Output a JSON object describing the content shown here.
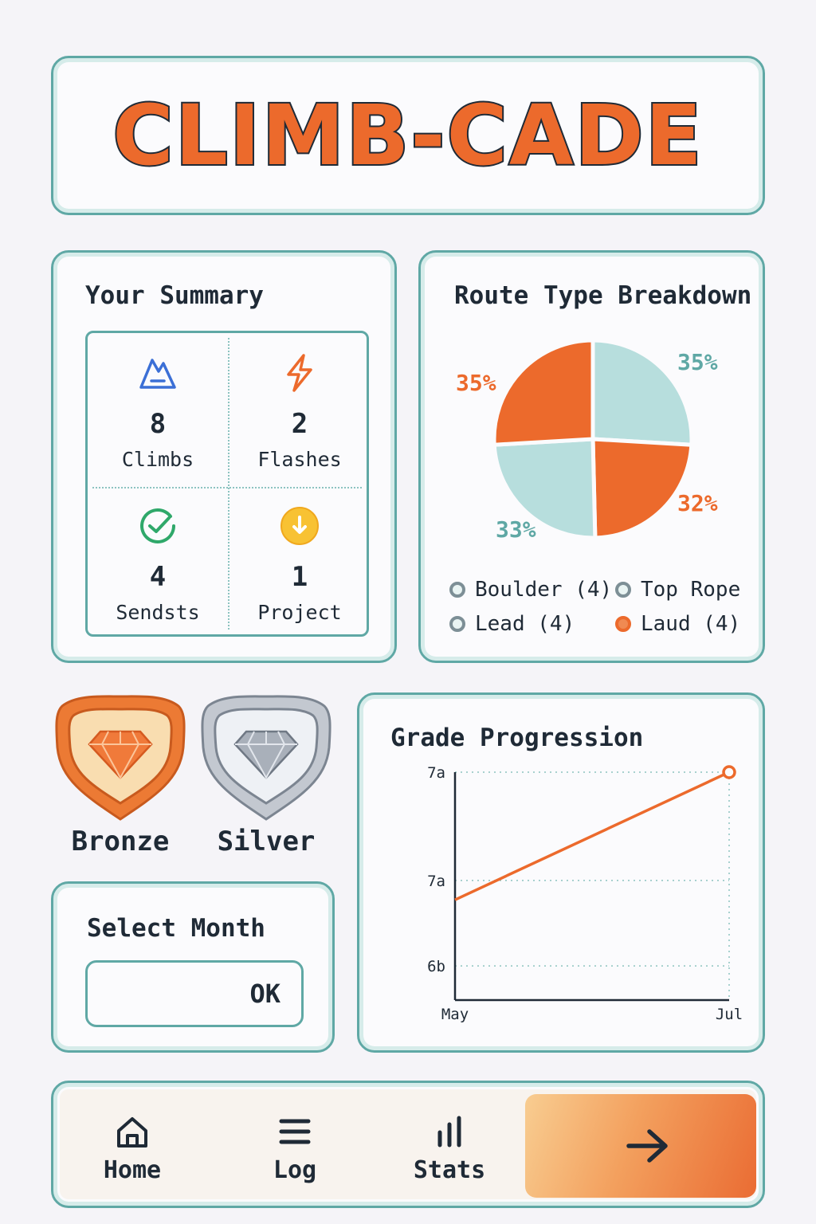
{
  "header": {
    "title": "CLIMB-CADE"
  },
  "summary": {
    "title": "Your Summary",
    "stats": [
      {
        "value": "8",
        "label": "Climbs",
        "icon": "mountain-icon",
        "color": "#3b6fd6"
      },
      {
        "value": "2",
        "label": "Flashes",
        "icon": "lightning-icon",
        "color": "#ec6a2c"
      },
      {
        "value": "4",
        "label": "Sendsts",
        "icon": "check-circle-icon",
        "color": "#2fa86a"
      },
      {
        "value": "1",
        "label": "Project",
        "icon": "arrow-down-circle-icon",
        "color": "#f5b52b"
      }
    ]
  },
  "route_breakdown": {
    "title": "Route Type Breakdown",
    "legend": [
      {
        "label": "Boulder (4)",
        "color": "#7d8f96"
      },
      {
        "label": "Top Rope",
        "color": "#7d8f96"
      },
      {
        "label": "Lead (4)",
        "color": "#7d8f96"
      },
      {
        "label": "Laud (4)",
        "color": "#ec6a2c"
      }
    ]
  },
  "badges": [
    {
      "label": "Bronze",
      "icon": "bronze-gem-badge-icon"
    },
    {
      "label": "Silver",
      "icon": "silver-gem-badge-icon"
    }
  ],
  "month_select": {
    "title": "Select Month",
    "button_label": "OK"
  },
  "grade_progression": {
    "title": "Grade Progression"
  },
  "nav": {
    "items": [
      {
        "label": "Home",
        "icon": "home-icon"
      },
      {
        "label": "Log",
        "icon": "menu-icon"
      },
      {
        "label": "Stats",
        "icon": "bar-chart-icon"
      }
    ],
    "action_icon": "arrow-right-icon"
  },
  "colors": {
    "accent": "#ec6a2c",
    "teal": "#5fa8a5",
    "light_teal": "#b7dedd",
    "ink": "#1f2a36"
  },
  "chart_data": [
    {
      "type": "pie",
      "title": "Route Type Breakdown",
      "slices": [
        {
          "label": "35%",
          "value": 35,
          "color": "#b7dedd"
        },
        {
          "label": "32%",
          "value": 32,
          "color": "#ec6a2c"
        },
        {
          "label": "33%",
          "value": 33,
          "color": "#b7dedd"
        },
        {
          "label": "35%",
          "value": 35,
          "color": "#ec6a2c"
        }
      ]
    },
    {
      "type": "line",
      "title": "Grade Progression",
      "x_ticks": [
        "May",
        "Jul"
      ],
      "y_ticks": [
        "6b",
        "7a",
        "7a"
      ],
      "series": [
        {
          "values": [
            {
              "x": "May",
              "y": 0.88
            },
            {
              "x": "Jul",
              "y": 2.0
            }
          ]
        }
      ],
      "ylim": [
        0,
        2
      ],
      "grid": true
    }
  ]
}
